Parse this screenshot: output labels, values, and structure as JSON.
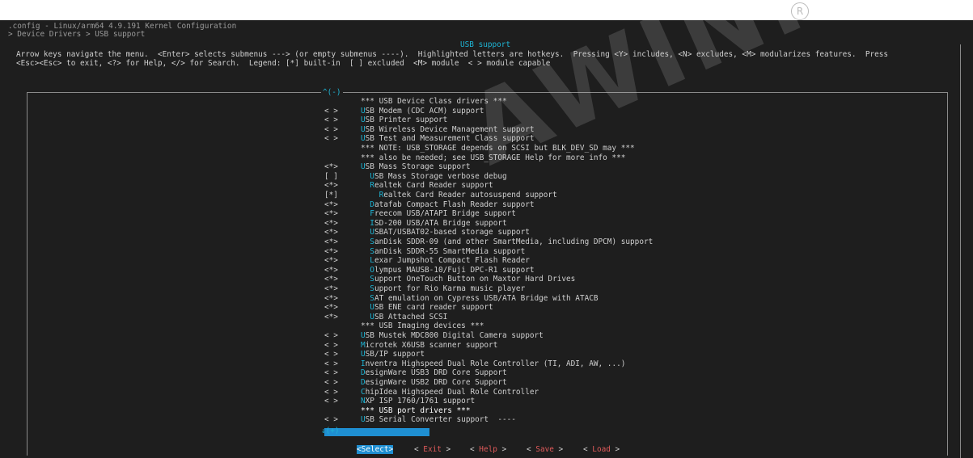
{
  "window": {
    "title": ".config - Linux/arm64 4.9.191 Kernel Configuration",
    "breadcrumb": "> Device Drivers > USB support "
  },
  "dialog": {
    "title": "USB support",
    "help_line1": "Arrow keys navigate the menu.  <Enter> selects submenus ---> (or empty submenus ----).  Highlighted letters are hotkeys.  Pressing <Y> includes, <N> excludes, <M> modularizes features.  Press",
    "help_line2": "<Esc><Esc> to exit, <?> for Help, </> for Search.  Legend: [*] built-in  [ ] excluded  <M> module  < > module capable",
    "scroll_top": "^(-)",
    "scroll_bottom": "↓(+)"
  },
  "menu": [
    {
      "mark": "",
      "indent": "",
      "hotkey": "",
      "rest": "*** USB Device Class drivers ***"
    },
    {
      "mark": "< >",
      "indent": "",
      "hotkey": "U",
      "rest": "SB Modem (CDC ACM) support"
    },
    {
      "mark": "< >",
      "indent": "",
      "hotkey": "U",
      "rest": "SB Printer support"
    },
    {
      "mark": "< >",
      "indent": "",
      "hotkey": "U",
      "rest": "SB Wireless Device Management support"
    },
    {
      "mark": "< >",
      "indent": "",
      "hotkey": "U",
      "rest": "SB Test and Measurement Class support"
    },
    {
      "mark": "",
      "indent": "",
      "hotkey": "",
      "rest": "*** NOTE: USB_STORAGE depends on SCSI but BLK_DEV_SD may ***"
    },
    {
      "mark": "",
      "indent": "",
      "hotkey": "",
      "rest": "*** also be needed; see USB_STORAGE Help for more info ***"
    },
    {
      "mark": "<*>",
      "indent": "",
      "hotkey": "U",
      "rest": "SB Mass Storage support"
    },
    {
      "mark": "[ ]",
      "indent": "  ",
      "hotkey": "U",
      "rest": "SB Mass Storage verbose debug"
    },
    {
      "mark": "<*>",
      "indent": "  ",
      "hotkey": "R",
      "rest": "ealtek Card Reader support"
    },
    {
      "mark": "[*]",
      "indent": "    ",
      "hotkey": "R",
      "rest": "ealtek Card Reader autosuspend support"
    },
    {
      "mark": "<*>",
      "indent": "  ",
      "hotkey": "D",
      "rest": "atafab Compact Flash Reader support"
    },
    {
      "mark": "<*>",
      "indent": "  ",
      "hotkey": "F",
      "rest": "reecom USB/ATAPI Bridge support"
    },
    {
      "mark": "<*>",
      "indent": "  ",
      "hotkey": "I",
      "rest": "SD-200 USB/ATA Bridge support"
    },
    {
      "mark": "<*>",
      "indent": "  ",
      "hotkey": "U",
      "rest": "SBAT/USBAT02-based storage support"
    },
    {
      "mark": "<*>",
      "indent": "  ",
      "hotkey": "S",
      "rest": "anDisk SDDR-09 (and other SmartMedia, including DPCM) support"
    },
    {
      "mark": "<*>",
      "indent": "  ",
      "hotkey": "S",
      "rest": "anDisk SDDR-55 SmartMedia support"
    },
    {
      "mark": "<*>",
      "indent": "  ",
      "hotkey": "L",
      "rest": "exar Jumpshot Compact Flash Reader"
    },
    {
      "mark": "<*>",
      "indent": "  ",
      "hotkey": "O",
      "rest": "lympus MAUSB-10/Fuji DPC-R1 support"
    },
    {
      "mark": "<*>",
      "indent": "  ",
      "hotkey": "S",
      "rest": "upport OneTouch Button on Maxtor Hard Drives"
    },
    {
      "mark": "<*>",
      "indent": "  ",
      "hotkey": "S",
      "rest": "upport for Rio Karma music player"
    },
    {
      "mark": "<*>",
      "indent": "  ",
      "hotkey": "S",
      "rest": "AT emulation on Cypress USB/ATA Bridge with ATACB"
    },
    {
      "mark": "<*>",
      "indent": "  ",
      "hotkey": "U",
      "rest": "SB ENE card reader support"
    },
    {
      "mark": "<*>",
      "indent": "  ",
      "hotkey": "U",
      "rest": "SB Attached SCSI"
    },
    {
      "mark": "",
      "indent": "",
      "hotkey": "",
      "rest": "*** USB Imaging devices ***"
    },
    {
      "mark": "< >",
      "indent": "",
      "hotkey": "U",
      "rest": "SB Mustek MDC800 Digital Camera support"
    },
    {
      "mark": "< >",
      "indent": "",
      "hotkey": "M",
      "rest": "icrotek X6USB scanner support"
    },
    {
      "mark": "< >",
      "indent": "",
      "hotkey": "U",
      "rest": "SB/IP support"
    },
    {
      "mark": "< >",
      "indent": "",
      "hotkey": "I",
      "rest": "nventra Highspeed Dual Role Controller (TI, ADI, AW, ...)"
    },
    {
      "mark": "< >",
      "indent": "",
      "hotkey": "D",
      "rest": "esignWare USB3 DRD Core Support"
    },
    {
      "mark": "< >",
      "indent": "",
      "hotkey": "D",
      "rest": "esignWare USB2 DRD Core Support"
    },
    {
      "mark": "< >",
      "indent": "",
      "hotkey": "C",
      "rest": "hipIdea Highspeed Dual Role Controller"
    },
    {
      "mark": "< >",
      "indent": "",
      "hotkey": "N",
      "rest": "XP ISP 1760/1761 support"
    },
    {
      "mark": "",
      "indent": "",
      "hotkey": "",
      "rest": "*** USB port drivers ***",
      "selected": true
    },
    {
      "mark": "< >",
      "indent": "",
      "hotkey": "U",
      "rest": "SB Serial Converter support  ----"
    }
  ],
  "buttons": [
    {
      "open": "<",
      "hotkey": "S",
      "rest": "elect",
      "close": ">",
      "selected": true
    },
    {
      "open": "< ",
      "hotkey": "E",
      "rest": "xit",
      "close": " >"
    },
    {
      "open": "< ",
      "hotkey": "H",
      "rest": "elp",
      "close": " >"
    },
    {
      "open": "< ",
      "hotkey": "S",
      "rest": "ave",
      "close": " >"
    },
    {
      "open": "< ",
      "hotkey": "L",
      "rest": "oad",
      "close": " >"
    }
  ],
  "watermark": {
    "text": "AWINNER",
    "symbol": "R"
  },
  "colors": {
    "background": "#1e1e1e",
    "text": "#cfcfcf",
    "hotkey": "#1eb4d4",
    "selection": "#1f8fd2"
  }
}
